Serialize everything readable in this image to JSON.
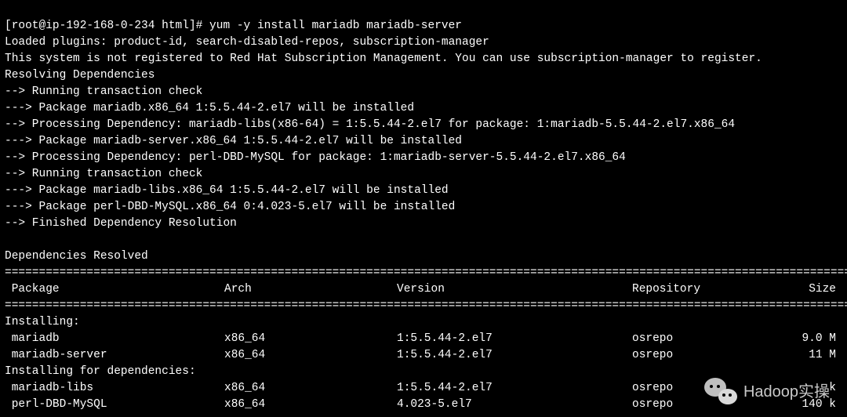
{
  "prompt": {
    "user_host": "[root@ip-192-168-0-234 html]#",
    "command": "yum -y install mariadb mariadb-server"
  },
  "lines": [
    "Loaded plugins: product-id, search-disabled-repos, subscription-manager",
    "This system is not registered to Red Hat Subscription Management. You can use subscription-manager to register.",
    "Resolving Dependencies",
    "--> Running transaction check",
    "---> Package mariadb.x86_64 1:5.5.44-2.el7 will be installed",
    "--> Processing Dependency: mariadb-libs(x86-64) = 1:5.5.44-2.el7 for package: 1:mariadb-5.5.44-2.el7.x86_64",
    "---> Package mariadb-server.x86_64 1:5.5.44-2.el7 will be installed",
    "--> Processing Dependency: perl-DBD-MySQL for package: 1:mariadb-server-5.5.44-2.el7.x86_64",
    "--> Running transaction check",
    "---> Package mariadb-libs.x86_64 1:5.5.44-2.el7 will be installed",
    "---> Package perl-DBD-MySQL.x86_64 0:4.023-5.el7 will be installed",
    "--> Finished Dependency Resolution",
    "",
    "Dependencies Resolved",
    ""
  ],
  "rule": "=========================================================================================================================================",
  "headers": {
    "package": " Package",
    "arch": "Arch",
    "version": "Version",
    "repository": "Repository",
    "size": "Size"
  },
  "sections": [
    {
      "title": "Installing:",
      "rows": [
        {
          "pkg": " mariadb",
          "arch": "x86_64",
          "ver": "1:5.5.44-2.el7",
          "repo": "osrepo",
          "size": "9.0 M"
        },
        {
          "pkg": " mariadb-server",
          "arch": "x86_64",
          "ver": "1:5.5.44-2.el7",
          "repo": "osrepo",
          "size": "11 M"
        }
      ]
    },
    {
      "title": "Installing for dependencies:",
      "rows": [
        {
          "pkg": " mariadb-libs",
          "arch": "x86_64",
          "ver": "1:5.5.44-2.el7",
          "repo": "osrepo",
          "size": "  k"
        },
        {
          "pkg": " perl-DBD-MySQL",
          "arch": "x86_64",
          "ver": "4.023-5.el7",
          "repo": "osrepo",
          "size": "140 k"
        }
      ]
    }
  ],
  "watermark": "Hadoop实操"
}
